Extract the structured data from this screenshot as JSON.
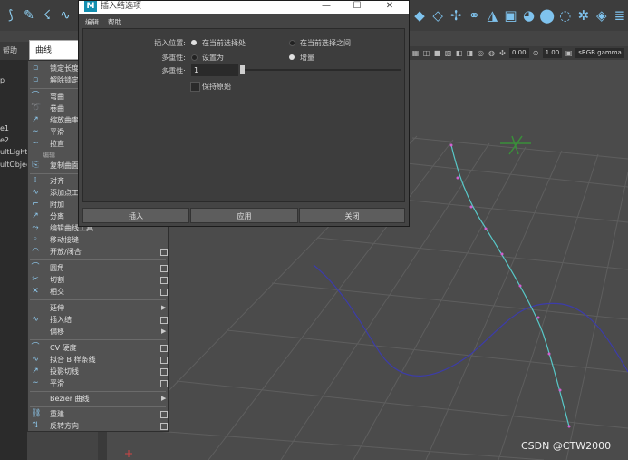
{
  "dialog": {
    "title": "插入结选项",
    "menu": [
      "编辑",
      "帮助"
    ],
    "insert_location_label": "插入位置:",
    "insert_location_options": [
      "在当前选择处",
      "在当前选择之间"
    ],
    "multiplicity_label": "多重性:",
    "multiplicity_options": [
      "设置为",
      "增量"
    ],
    "multiplicity_value_label": "多重性:",
    "multiplicity_value": "1",
    "keep_original": "保持原始",
    "buttons": [
      "插入",
      "应用",
      "关闭"
    ]
  },
  "panel": {
    "help": "帮助",
    "curves_tab": "曲线"
  },
  "outliner": {
    "items": [
      "p",
      "e1",
      "e2",
      "ultLightS",
      "ultObjec"
    ]
  },
  "viewport_toolbar": {
    "field_a": "0.00",
    "field_b": "1.00",
    "colorspace": "sRGB gamma"
  },
  "menu": {
    "lock_length": "锁定长度",
    "unlock_length": "解除锁定",
    "bend": "弯曲",
    "curl": "卷曲",
    "scale_curvature": "缩放曲率",
    "smooth": "平滑",
    "straighten": "拉直",
    "section_edit": "编辑",
    "duplicate_surface_curves": "复制曲面",
    "align": "对齐",
    "add_points_tool": "添加点工",
    "attach": "附加",
    "detach": "分离",
    "edit_curve_tool": "编辑曲线工具",
    "move_seam": "移动接缝",
    "open_close": "开放/闭合",
    "fillet": "圆角",
    "cut": "切割",
    "intersect": "相交",
    "extend": "延伸",
    "insert_knot": "插入结",
    "offset": "偏移",
    "cv_hardness": "CV 硬度",
    "fit_bspline": "拟合 B 样条线",
    "project_tangent": "投影切线",
    "smooth2": "平滑",
    "bezier_curves": "Bezier 曲线",
    "rebuild": "重建",
    "reverse_direction": "反转方向"
  },
  "watermark": "CSDN @CTW2000",
  "icons": [
    "lasso-icon",
    "paint-icon",
    "snap-icon",
    "curve-icon",
    "maya-logo-icon"
  ]
}
